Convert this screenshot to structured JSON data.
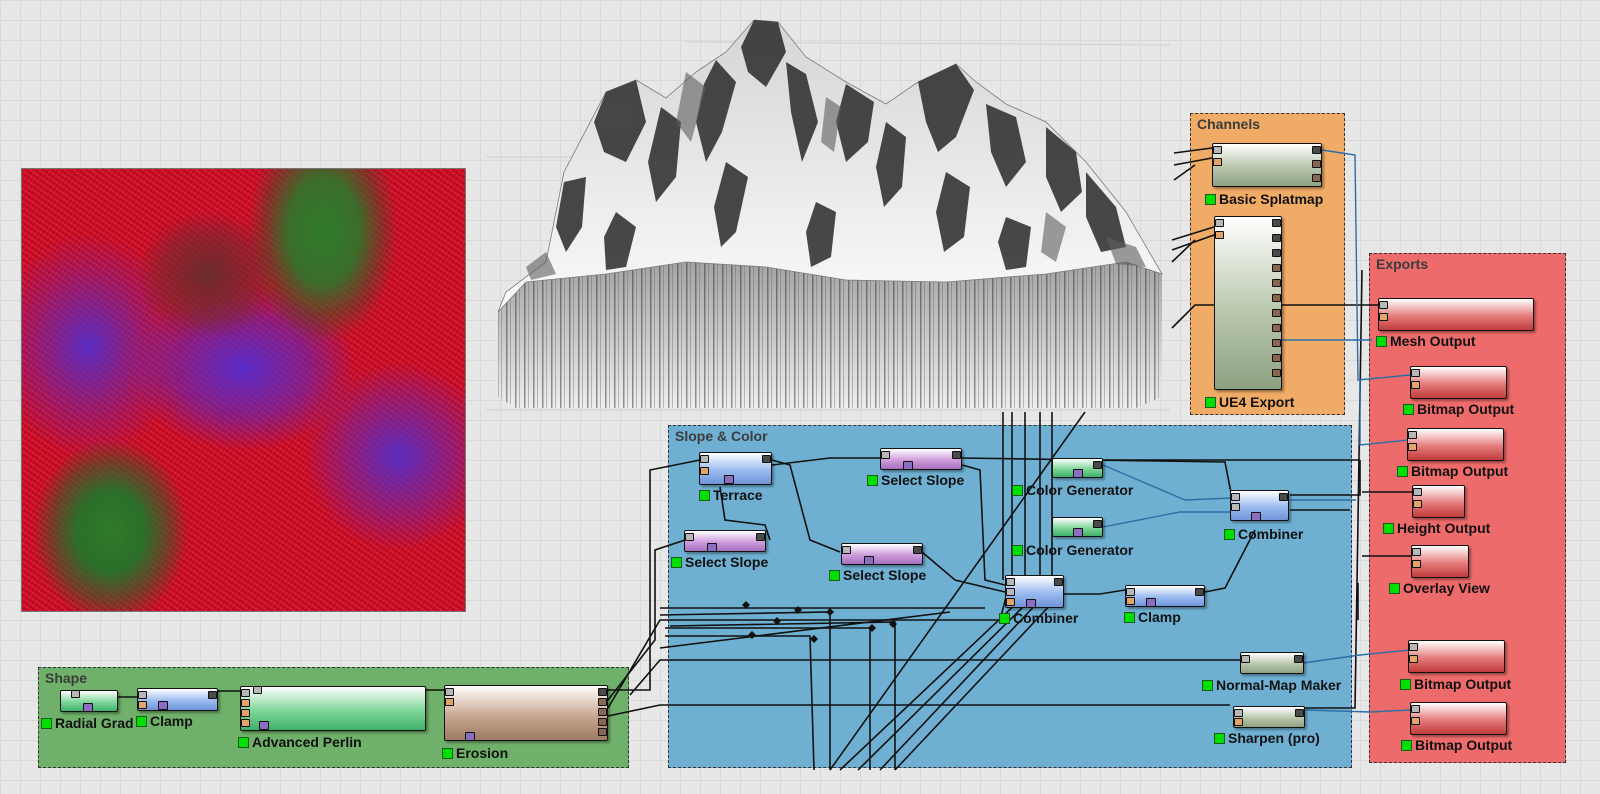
{
  "groups": {
    "shape": "Shape",
    "slope_color": "Slope & Color",
    "channels": "Channels",
    "exports": "Exports"
  },
  "nodes": {
    "radial_grad": "Radial Grad",
    "clamp_shape": "Clamp",
    "advanced_perlin": "Advanced Perlin",
    "erosion": "Erosion",
    "terrace": "Terrace",
    "select_slope_1": "Select Slope",
    "select_slope_2": "Select Slope",
    "select_slope_3": "Select Slope",
    "color_generator_1": "Color Generator",
    "color_generator_2": "Color Generator",
    "combiner_1": "Combiner",
    "combiner_2": "Combiner",
    "clamp_color": "Clamp",
    "normal_map_maker": "Normal-Map Maker",
    "sharpen_pro": "Sharpen (pro)",
    "basic_splatmap": "Basic Splatmap",
    "ue4_export": "UE4 Export",
    "mesh_output": "Mesh Output",
    "bitmap_output_1": "Bitmap Output",
    "bitmap_output_2": "Bitmap Output",
    "height_output": "Height Output",
    "overlay_view": "Overlay View",
    "bitmap_output_3": "Bitmap Output",
    "bitmap_output_4": "Bitmap Output"
  },
  "colors": {
    "shape_group": "#6fb06a",
    "slope_group": "#6fb0d2",
    "channels_group": "#f0ab66",
    "exports_group": "#ee6b6b",
    "status_led": "#00e000"
  }
}
